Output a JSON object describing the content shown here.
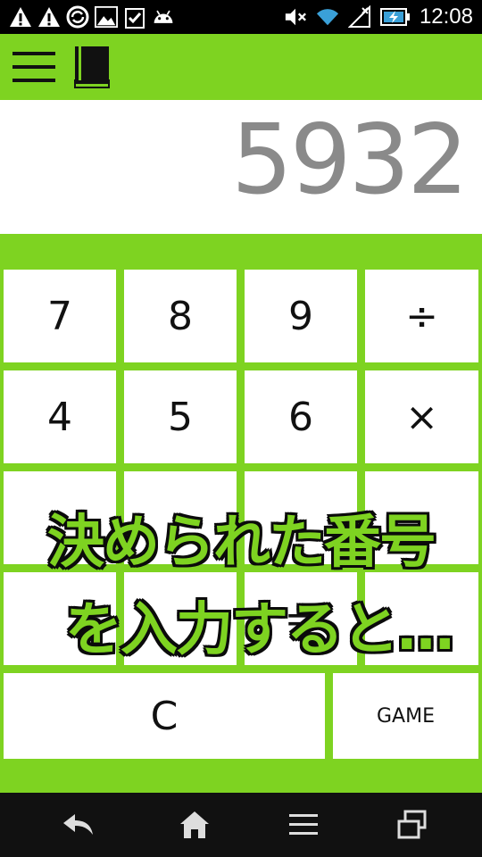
{
  "status_bar": {
    "time": "12:08",
    "icons_left": [
      "warning-icon",
      "warning-icon",
      "sync-icon",
      "image-icon",
      "clipboard-check-icon",
      "android-icon"
    ],
    "icons_right": [
      "mute-icon",
      "wifi-icon",
      "no-signal-icon",
      "battery-charging-icon"
    ]
  },
  "app_bar": {
    "icons": [
      "menu-icon",
      "book-icon"
    ],
    "background": "#7ed321"
  },
  "display": {
    "value": "5932"
  },
  "keypad": {
    "rows": [
      [
        "7",
        "8",
        "9",
        "÷"
      ],
      [
        "4",
        "5",
        "6",
        "×"
      ],
      [
        "",
        "",
        "",
        ""
      ],
      [
        "",
        "",
        "=",
        ""
      ]
    ],
    "clear_label": "C",
    "game_label": "GAME"
  },
  "caption": {
    "line1": "決められた番号",
    "line2": "を入力すると…"
  },
  "nav_bar": {
    "icons": [
      "back-icon",
      "home-icon",
      "menu-icon",
      "recent-apps-icon"
    ]
  },
  "colors": {
    "accent": "#7ed321",
    "display_text": "#8a8a8a"
  }
}
